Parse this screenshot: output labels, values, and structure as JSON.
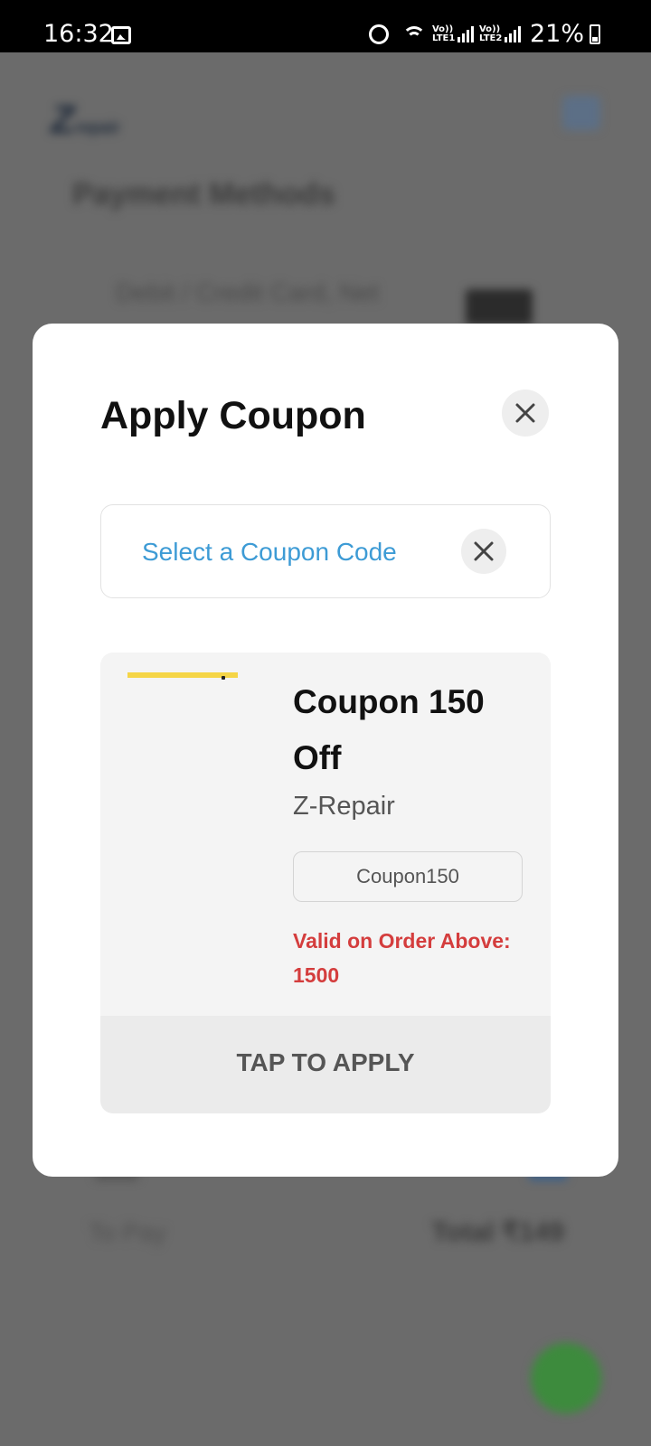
{
  "status_bar": {
    "time": "16:32",
    "lte1": "Vo)) LTE1",
    "lte2": "Vo)) LTE2",
    "battery": "21%"
  },
  "background": {
    "page_title": "Payment Methods",
    "method_label": "Debit / Credit Card, Net",
    "to_pay_label": "To Pay",
    "total_label": "Total ₹149"
  },
  "modal": {
    "title": "Apply Coupon",
    "select_placeholder": "Select a Coupon Code",
    "coupon": {
      "name": "Coupon 150 Off",
      "brand": "Z-Repair",
      "code": "Coupon150",
      "validity": "Valid on Order Above: 1500",
      "apply_label": "TAP TO APPLY"
    }
  },
  "colors": {
    "accent_blue": "#3d9bd5",
    "validity_red": "#d43d3d",
    "overlay": "#6b6b6b"
  },
  "icons": {
    "close": "close-icon",
    "clear": "close-icon"
  }
}
